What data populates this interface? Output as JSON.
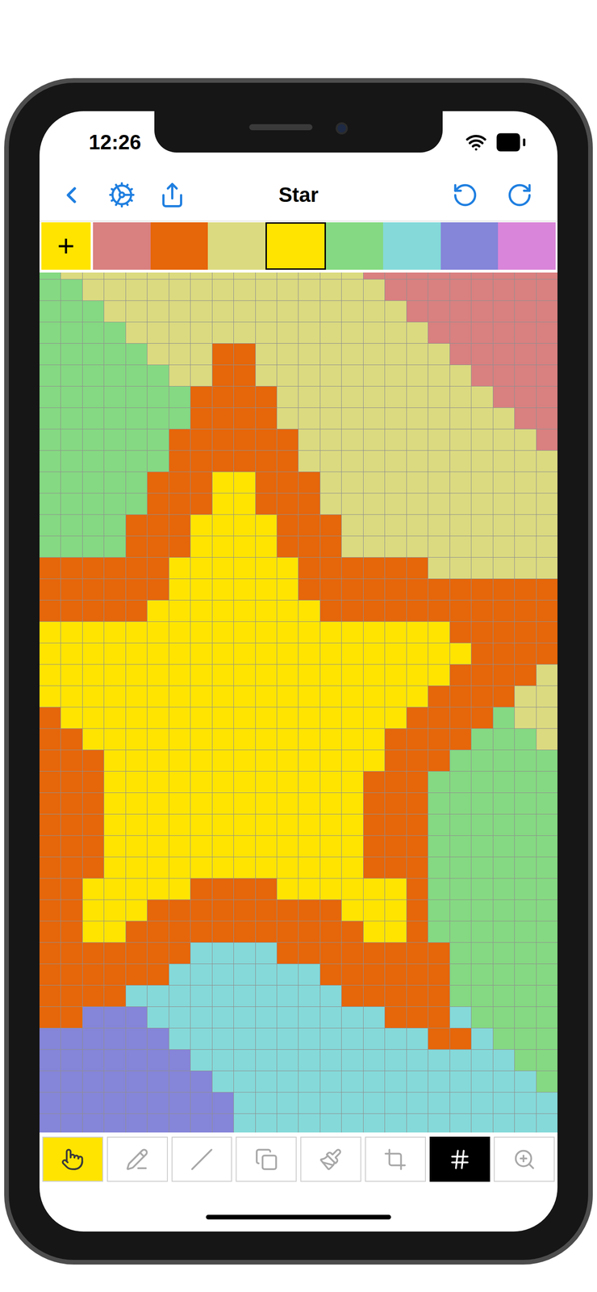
{
  "status_bar": {
    "time": "12:26"
  },
  "nav": {
    "title": "Star"
  },
  "add_button": {
    "label": "+"
  },
  "palette": [
    {
      "color": "#d98080",
      "selected": false
    },
    {
      "color": "#e6660a",
      "selected": false
    },
    {
      "color": "#dbda80",
      "selected": false
    },
    {
      "color": "#ffe400",
      "selected": true
    },
    {
      "color": "#85d982",
      "selected": false
    },
    {
      "color": "#85d9d9",
      "selected": false
    },
    {
      "color": "#8585d9",
      "selected": false
    },
    {
      "color": "#d985d9",
      "selected": false
    }
  ],
  "canvas": {
    "colors": {
      "R": "#d98080",
      "O": "#e6660a",
      "T": "#dbda80",
      "Y": "#ffe400",
      "G": "#85d982",
      "C": "#85d9d9",
      "P": "#8585d9",
      "M": "#d985d9"
    },
    "rows": [
      "GTTTTTTTTTTTTTTRRRRRRRRR",
      "GGTTTTTTTTTTTTTTRRRRRRRR",
      "GGGTTTTTTTTTTTTTTRRRRRRR",
      "GGGGTTTTTTTTTTTTTTRRRRRR",
      "GGGGGTTTOOTTTTTTTTTRRRRR",
      "GGGGGGTTOOTTTTTTTTTTRRRR",
      "GGGGGGGOOOOTTTTTTTTTTRRR",
      "GGGGGGGOOOOTTTTTTTTTTTRR",
      "GGGGGGOOOOOOTTTTTTTTTTTR",
      "GGGGGGOOOOOOTTTTTTTTTTTT",
      "GGGGGOOOYYOOOTTTTTTTTTTT",
      "GGGGGOOOYYOOOTTTTTTTTTTT",
      "GGGGOOOYYYYOOOTTTTTTTTTT",
      "GGGGOOOYYYYOOOTTTTTTTTTT",
      "OOOOOOYYYYYYOOOOOOTTTTTT",
      "OOOOOOYYYYYYOOOOOOOOOOOO",
      "OOOOOYYYYYYYYOOOOOOOOOOO",
      "YYYYYYYYYYYYYYYYYYYOOOOO",
      "YYYYYYYYYYYYYYYYYYYYOOOO",
      "YYYYYYYYYYYYYYYYYYYOOOOT",
      "YYYYYYYYYYYYYYYYYYOOOOTT",
      "OYYYYYYYYYYYYYYYYOOOOGTT",
      "OOYYYYYYYYYYYYYYOOOOGGGT",
      "OOOYYYYYYYYYYYYYOOOGGGGG",
      "OOOYYYYYYYYYYYYOOOGGGGGG",
      "OOOYYYYYYYYYYYYOOOGGGGGG",
      "OOOYYYYYYYYYYYYOOOGGGGGG",
      "OOOYYYYYYYYYYYYOOOGGGGGG",
      "OOOYYYYYYYYYYYYOOOGGGGGG",
      "OOYYYYYOOOOYYYYYYOGGGGGG",
      "OOYYYOOOOOOOOOYYYOGGGGGG",
      "OOYYOOOOOOOOOOOYYOGGGGGG",
      "OOOOOOOCCCCOOOOOOOOGGGGG",
      "OOOOOOCCCCCCCOOOOOOGGGGG",
      "OOOOCCCCCCCCCCOOOOOGGGGG",
      "OOPPPCCCCCCCCCCCOOOCGGGG",
      "PPPPPPCCCCCCCCCCCCOOCGGG",
      "PPPPPPPCCCCCCCCCCCCCCCGG",
      "PPPPPPPPCCCCCCCCCCCCCCCG",
      "PPPPPPPPPCCCCCCCCCCCCCCC",
      "PPPPPPPPPCCCCCCCCCCCCCCC"
    ]
  },
  "toolbar": [
    {
      "kind": "tool",
      "selected": true
    },
    {
      "kind": "tool",
      "selected": false
    },
    {
      "kind": "tool",
      "selected": false
    },
    {
      "kind": "tool",
      "selected": false
    },
    {
      "kind": "tool",
      "selected": false
    },
    {
      "kind": "tool",
      "selected": false
    },
    {
      "kind": "toggle",
      "selected": false,
      "on": true
    },
    {
      "kind": "tool",
      "selected": false
    }
  ]
}
